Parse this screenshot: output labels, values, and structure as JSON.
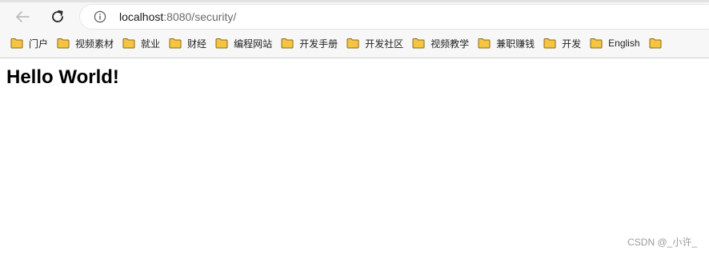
{
  "browser": {
    "address": {
      "host": "localhost",
      "path": ":8080/security/"
    },
    "bookmarks": [
      {
        "label": "门户",
        "icon": "folder-icon"
      },
      {
        "label": "视频素材",
        "icon": "folder-icon"
      },
      {
        "label": "就业",
        "icon": "folder-icon"
      },
      {
        "label": "财经",
        "icon": "folder-icon"
      },
      {
        "label": "编程网站",
        "icon": "folder-icon"
      },
      {
        "label": "开发手册",
        "icon": "folder-icon"
      },
      {
        "label": "开发社区",
        "icon": "folder-icon"
      },
      {
        "label": "视频教学",
        "icon": "folder-icon"
      },
      {
        "label": "兼职赚钱",
        "icon": "folder-icon"
      },
      {
        "label": "开发",
        "icon": "folder-icon"
      },
      {
        "label": "English",
        "icon": "folder-icon"
      },
      {
        "label": "",
        "icon": "folder-icon"
      }
    ],
    "colors": {
      "folder_fill": "#f5c542",
      "folder_stroke": "#8a6a12"
    }
  },
  "page": {
    "heading": "Hello World!",
    "watermark": "CSDN @_小许_"
  }
}
